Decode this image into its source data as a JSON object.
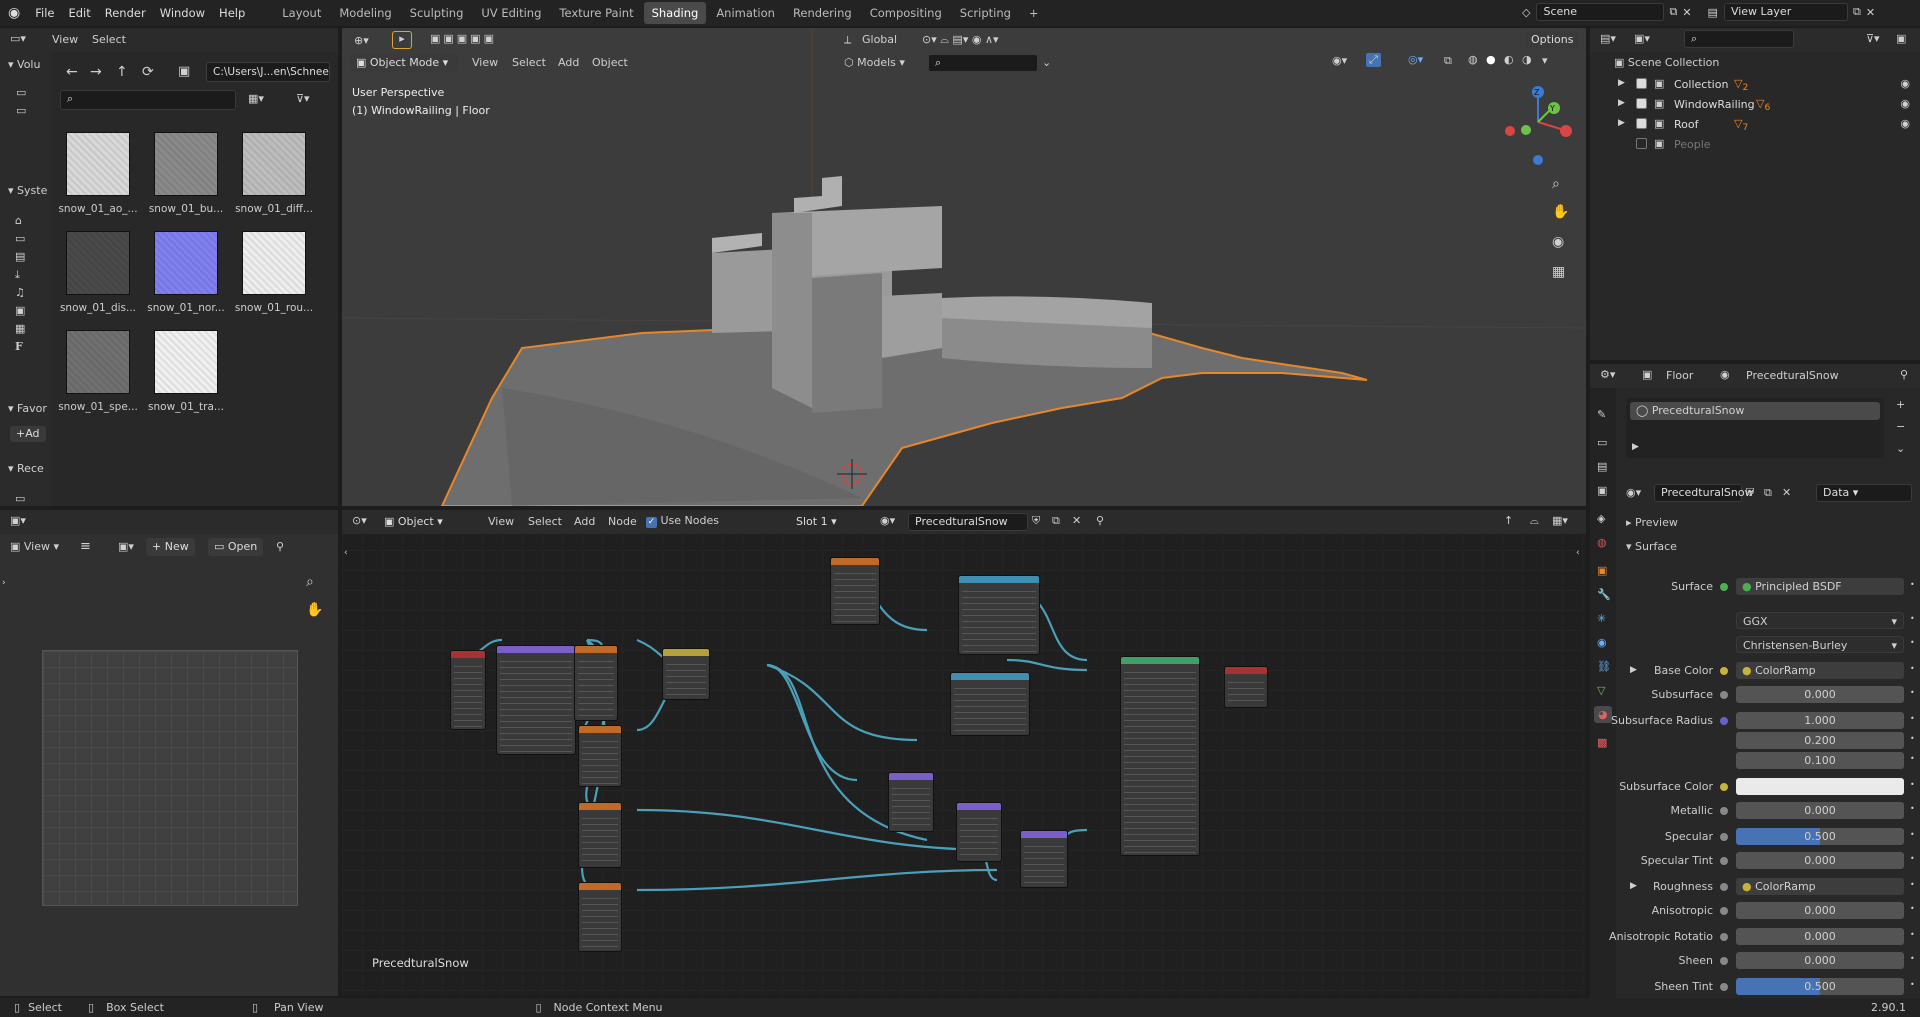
{
  "topbar": {
    "menus": [
      "File",
      "Edit",
      "Render",
      "Window",
      "Help"
    ],
    "workspaces": [
      "Layout",
      "Modeling",
      "Sculpting",
      "UV Editing",
      "Texture Paint",
      "Shading",
      "Animation",
      "Rendering",
      "Compositing",
      "Scripting"
    ],
    "active_workspace": "Shading",
    "add_tab": "+",
    "scene": "Scene",
    "view_layer": "View Layer"
  },
  "file_browser": {
    "menus": [
      "View",
      "Select"
    ],
    "path": "C:\\Users\\J...en\\Schnee\\",
    "sections": [
      "Volu",
      "Syste",
      "Favor",
      "Rece"
    ],
    "add_label": "Ad",
    "files": [
      {
        "name": "snow_01_ao_...",
        "color": "#d8d8d8"
      },
      {
        "name": "snow_01_bu...",
        "color": "#8a8a8a"
      },
      {
        "name": "snow_01_diff...",
        "color": "#bdbdbd"
      },
      {
        "name": "snow_01_dis...",
        "color": "#4a4a4a"
      },
      {
        "name": "snow_01_nor...",
        "color": "#8080f0"
      },
      {
        "name": "snow_01_rou...",
        "color": "#eeeeee"
      },
      {
        "name": "snow_01_spe...",
        "color": "#707070"
      },
      {
        "name": "snow_01_tra...",
        "color": "#f0f0f0"
      }
    ]
  },
  "viewport": {
    "mode": "Object Mode",
    "menus": [
      "View",
      "Select",
      "Add",
      "Object"
    ],
    "transform": "Global",
    "options": "Options",
    "overlay_title": "User Perspective",
    "overlay_sub": "(1) WindowRailing | Floor",
    "collection_filter": "Models"
  },
  "outliner": {
    "root": "Scene Collection",
    "items": [
      "Collection",
      "WindowRailing",
      "Roof",
      "People"
    ],
    "badges": {
      "Collection": "2",
      "WindowRailing": "6",
      "Roof": "7"
    }
  },
  "properties": {
    "object": "Floor",
    "material": "PrecedturalSnow",
    "slot_name": "PrecedturalSnow",
    "material_field": "PrecedturalSnow",
    "data_dropdown": "Data",
    "sections": {
      "preview": "Preview",
      "surface": "Surface"
    },
    "rows": [
      {
        "label": "Surface",
        "value": "Principled BSDF",
        "dot": "#4caf50",
        "style": "dark"
      },
      {
        "label": "",
        "value": "GGX",
        "dot": "",
        "style": "select"
      },
      {
        "label": "",
        "value": "Christensen-Burley",
        "dot": "",
        "style": "select"
      },
      {
        "label": "Base Color",
        "value": "ColorRamp",
        "dot": "#c7b23a",
        "style": "dark"
      },
      {
        "label": "Subsurface",
        "value": "0.000",
        "dot": "#888",
        "style": "num"
      },
      {
        "label": "Subsurface Radius",
        "value": "1.000",
        "dot": "#6363c7",
        "style": "num"
      },
      {
        "label": "",
        "value": "0.200",
        "dot": "",
        "style": "num"
      },
      {
        "label": "",
        "value": "0.100",
        "dot": "",
        "style": "num"
      },
      {
        "label": "Subsurface Color",
        "value": "",
        "dot": "#c7b23a",
        "style": "white"
      },
      {
        "label": "Metallic",
        "value": "0.000",
        "dot": "#888",
        "style": "num"
      },
      {
        "label": "Specular",
        "value": "0.500",
        "dot": "#888",
        "style": "blue"
      },
      {
        "label": "Specular Tint",
        "value": "0.000",
        "dot": "#888",
        "style": "num"
      },
      {
        "label": "Roughness",
        "value": "ColorRamp",
        "dot": "#888",
        "style": "dark"
      },
      {
        "label": "Anisotropic",
        "value": "0.000",
        "dot": "#888",
        "style": "num"
      },
      {
        "label": "Anisotropic Rotatio",
        "value": "0.000",
        "dot": "#888",
        "style": "num"
      },
      {
        "label": "Sheen",
        "value": "0.000",
        "dot": "#888",
        "style": "num"
      },
      {
        "label": "Sheen Tint",
        "value": "0.500",
        "dot": "#888",
        "style": "blue"
      }
    ]
  },
  "image_editor": {
    "view": "View",
    "new": "New",
    "open": "Open"
  },
  "node_editor": {
    "object": "Object",
    "menus": [
      "View",
      "Select",
      "Add",
      "Node"
    ],
    "use_nodes": "Use Nodes",
    "slot": "Slot 1",
    "material": "PrecedturalSnow",
    "canvas_label": "PrecedturalSnow"
  },
  "statusbar": {
    "select": "Select",
    "box_select": "Box Select",
    "pan_view": "Pan View",
    "node_context": "Node Context Menu",
    "version": "2.90.1"
  }
}
